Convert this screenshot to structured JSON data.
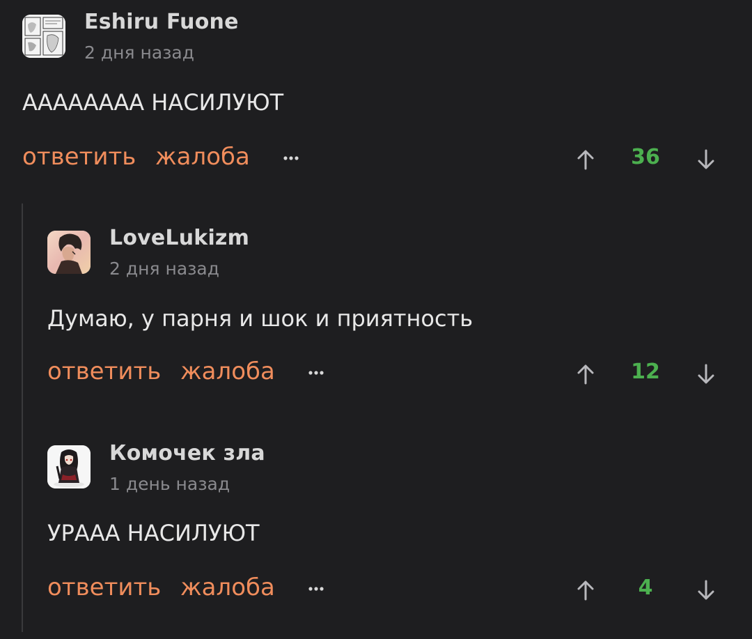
{
  "comments": [
    {
      "author": "Eshiru Fuone",
      "time": "2 дня назад",
      "text": "АААААААА НАСИЛУЮТ",
      "actions": {
        "reply": "ответить",
        "report": "жалоба"
      },
      "score": "36"
    },
    {
      "author": "LoveLukizm",
      "time": "2 дня назад",
      "text": "Думаю, у парня и шок и приятность",
      "actions": {
        "reply": "ответить",
        "report": "жалоба"
      },
      "score": "12"
    },
    {
      "author": "Комочек зла",
      "time": "1 день назад",
      "text": "УРААА НАСИЛУЮТ",
      "actions": {
        "reply": "ответить",
        "report": "жалоба"
      },
      "score": "4"
    }
  ],
  "icons": {
    "more": "more-dots-icon",
    "upvote": "arrow-up-icon",
    "downvote": "arrow-down-icon"
  },
  "colors": {
    "background": "#1e1e20",
    "action_link": "#f08d5c",
    "score_positive": "#4cb04f",
    "muted": "#8a8a8e"
  }
}
